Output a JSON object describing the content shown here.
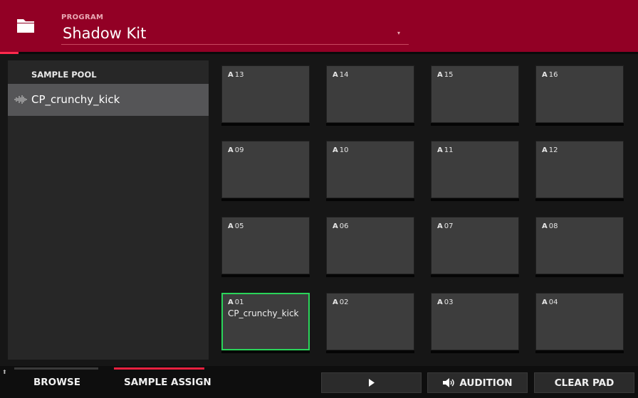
{
  "header": {
    "program_label": "PROGRAM",
    "program_name": "Shadow Kit",
    "accent_color": "#920025"
  },
  "sample_pool": {
    "title": "SAMPLE POOL",
    "items": [
      {
        "label": "CP_crunchy_kick"
      }
    ]
  },
  "pads": [
    {
      "bank": "A",
      "num": "13",
      "sample": ""
    },
    {
      "bank": "A",
      "num": "14",
      "sample": ""
    },
    {
      "bank": "A",
      "num": "15",
      "sample": ""
    },
    {
      "bank": "A",
      "num": "16",
      "sample": ""
    },
    {
      "bank": "A",
      "num": "09",
      "sample": ""
    },
    {
      "bank": "A",
      "num": "10",
      "sample": ""
    },
    {
      "bank": "A",
      "num": "11",
      "sample": ""
    },
    {
      "bank": "A",
      "num": "12",
      "sample": ""
    },
    {
      "bank": "A",
      "num": "05",
      "sample": ""
    },
    {
      "bank": "A",
      "num": "06",
      "sample": ""
    },
    {
      "bank": "A",
      "num": "07",
      "sample": ""
    },
    {
      "bank": "A",
      "num": "08",
      "sample": ""
    },
    {
      "bank": "A",
      "num": "01",
      "sample": "CP_crunchy_kick",
      "selected": true
    },
    {
      "bank": "A",
      "num": "02",
      "sample": ""
    },
    {
      "bank": "A",
      "num": "03",
      "sample": ""
    },
    {
      "bank": "A",
      "num": "04",
      "sample": ""
    }
  ],
  "bottom": {
    "browse": "BROWSE",
    "sample_assign": "SAMPLE ASSIGN",
    "audition": "AUDITION",
    "clear_pad": "CLEAR PAD",
    "selected_color": "#2ad55a"
  }
}
